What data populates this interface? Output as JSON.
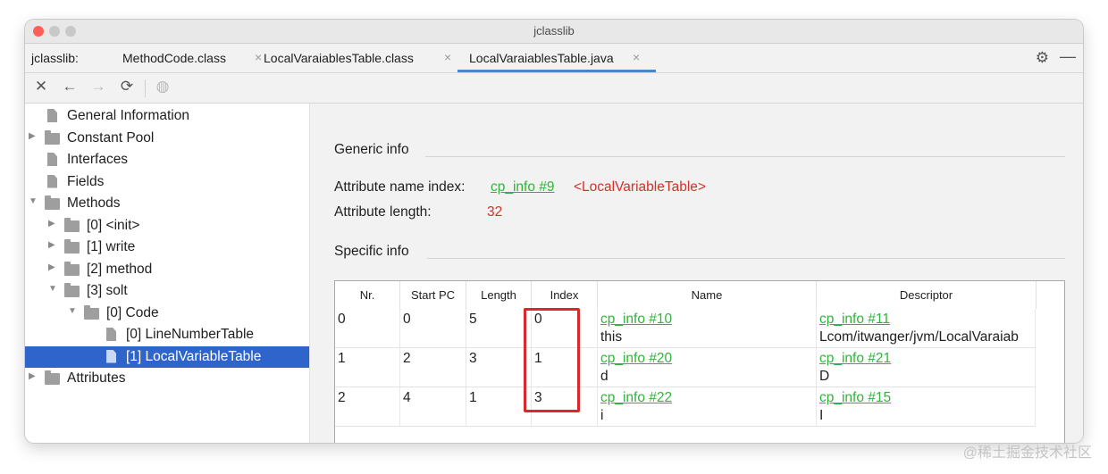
{
  "window": {
    "title": "jclasslib"
  },
  "tabbar": {
    "prefix": "jclasslib:",
    "tabs": [
      {
        "label": "MethodCode.class",
        "close": "×"
      },
      {
        "label": "LocalVaraiablesTable.class",
        "close": "×"
      },
      {
        "label": "LocalVaraiablesTable.java",
        "close": "×"
      }
    ],
    "active_index": 2,
    "settings_icon": "⚙",
    "minimize_icon": "—"
  },
  "toolbar": {
    "icons": [
      "close-icon",
      "arrow-left-icon",
      "arrow-right-icon",
      "refresh-icon",
      "globe-icon"
    ],
    "glyphs": {
      "close": "✕",
      "back": "←",
      "forward": "→",
      "refresh": "⟳",
      "web": "◍"
    }
  },
  "tree": [
    {
      "label": "General Information",
      "type": "file",
      "depth": 0,
      "arrow": ""
    },
    {
      "label": "Constant Pool",
      "type": "folder",
      "depth": 0,
      "arrow": "▶"
    },
    {
      "label": "Interfaces",
      "type": "file",
      "depth": 0,
      "arrow": ""
    },
    {
      "label": "Fields",
      "type": "file",
      "depth": 0,
      "arrow": ""
    },
    {
      "label": "Methods",
      "type": "folder",
      "depth": 0,
      "arrow": "▼"
    },
    {
      "label": "[0] <init>",
      "type": "folder",
      "depth": 1,
      "arrow": "▶"
    },
    {
      "label": "[1] write",
      "type": "folder",
      "depth": 1,
      "arrow": "▶"
    },
    {
      "label": "[2] method",
      "type": "folder",
      "depth": 1,
      "arrow": "▶"
    },
    {
      "label": "[3] solt",
      "type": "folder",
      "depth": 1,
      "arrow": "▼"
    },
    {
      "label": "[0] Code",
      "type": "folder",
      "depth": 2,
      "arrow": "▼"
    },
    {
      "label": "[0] LineNumberTable",
      "type": "file",
      "depth": 3,
      "arrow": ""
    },
    {
      "label": "[1] LocalVariableTable",
      "type": "file",
      "depth": 3,
      "arrow": "",
      "selected": true
    },
    {
      "label": "Attributes",
      "type": "folder",
      "depth": 0,
      "arrow": "▶"
    }
  ],
  "generic_info": {
    "header": "Generic info",
    "name_index_label": "Attribute name index:",
    "name_index_link": "cp_info #9",
    "name_index_value": "<LocalVariableTable>",
    "length_label": "Attribute length:",
    "length_value": "32"
  },
  "specific_info": {
    "header": "Specific info",
    "columns": [
      "Nr.",
      "Start PC",
      "Length",
      "Index",
      "Name",
      "Descriptor"
    ],
    "rows": [
      {
        "nr": "0",
        "start_pc": "0",
        "length": "5",
        "index": "0",
        "name_link": "cp_info #10",
        "name_value": "this",
        "desc_link": "cp_info #11",
        "desc_value": "Lcom/itwanger/jvm/LocalVaraiab"
      },
      {
        "nr": "1",
        "start_pc": "2",
        "length": "3",
        "index": "1",
        "name_link": "cp_info #20",
        "name_value": "d",
        "desc_link": "cp_info #21",
        "desc_value": "D"
      },
      {
        "nr": "2",
        "start_pc": "4",
        "length": "1",
        "index": "3",
        "name_link": "cp_info #22",
        "name_value": "i",
        "desc_link": "cp_info #15",
        "desc_value": "I"
      }
    ]
  },
  "watermark": "@稀土掘金技术社区"
}
